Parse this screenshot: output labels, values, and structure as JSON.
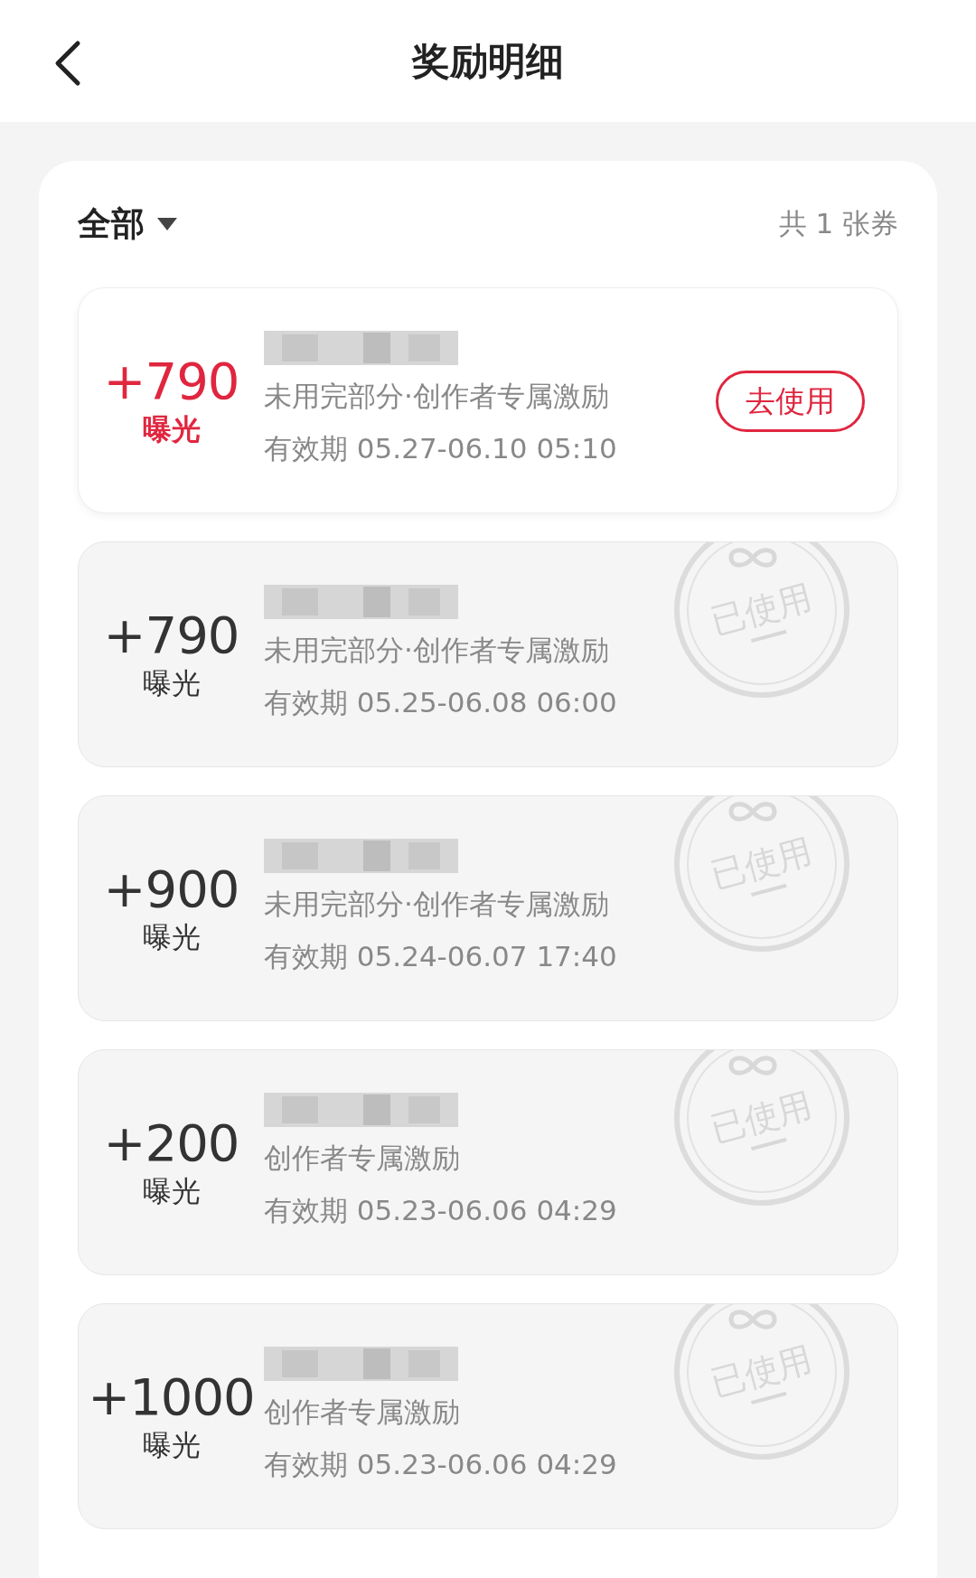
{
  "header": {
    "title": "奖励明细"
  },
  "filter": {
    "label": "全部",
    "count": "共 1 张券"
  },
  "coupons": [
    {
      "amount": "+790",
      "unit": "曝光",
      "description": "未用完部分·创作者专属激励",
      "validity": "有效期 05.27-06.10 05:10",
      "used": false,
      "action": "去使用"
    },
    {
      "amount": "+790",
      "unit": "曝光",
      "description": "未用完部分·创作者专属激励",
      "validity": "有效期 05.25-06.08 06:00",
      "used": true,
      "stamp": "已使用"
    },
    {
      "amount": "+900",
      "unit": "曝光",
      "description": "未用完部分·创作者专属激励",
      "validity": "有效期 05.24-06.07 17:40",
      "used": true,
      "stamp": "已使用"
    },
    {
      "amount": "+200",
      "unit": "曝光",
      "description": "创作者专属激励",
      "validity": "有效期 05.23-06.06 04:29",
      "used": true,
      "stamp": "已使用"
    },
    {
      "amount": "+1000",
      "unit": "曝光",
      "description": "创作者专属激励",
      "validity": "有效期 05.23-06.06 04:29",
      "used": true,
      "stamp": "已使用"
    }
  ]
}
